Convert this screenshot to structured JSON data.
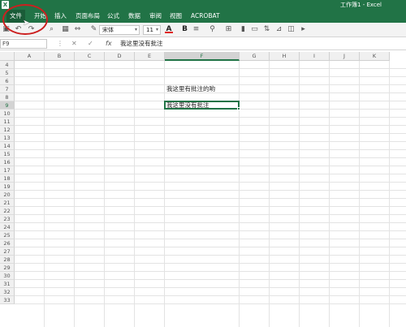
{
  "window": {
    "title": "工作簿1 - Excel",
    "app_logo": "X"
  },
  "ribbon": {
    "tabs": [
      "文件",
      "开始",
      "插入",
      "页面布局",
      "公式",
      "数据",
      "审阅",
      "视图",
      "ACROBAT"
    ]
  },
  "toolbar": {
    "font_name": "宋体",
    "font_size": "11",
    "font_color_letter": "A",
    "bold_label": "B",
    "icons": [
      "save-icon",
      "undo-icon",
      "redo-icon",
      "format-painter-icon",
      "font-color-icon",
      "bold-icon",
      "align-icon",
      "chart-icon"
    ]
  },
  "formula_bar": {
    "name_box": "F9",
    "cancel": "✕",
    "enter": "✓",
    "fx": "fx",
    "content": "我这里没有批注"
  },
  "sheet": {
    "columns": [
      "A",
      "B",
      "C",
      "D",
      "E",
      "F",
      "G",
      "H",
      "I",
      "J",
      "K"
    ],
    "rows": [
      "4",
      "5",
      "6",
      "7",
      "8",
      "9",
      "10",
      "11",
      "12",
      "13",
      "14",
      "15",
      "16",
      "17",
      "18",
      "19",
      "20",
      "21",
      "22",
      "23",
      "24",
      "25",
      "26",
      "27",
      "28",
      "29",
      "30",
      "31",
      "32",
      "33"
    ],
    "selected_column": "F",
    "selected_row": "9",
    "cells": {
      "F7": "我这里有批注的哟",
      "F9": "我这里没有批注"
    }
  }
}
